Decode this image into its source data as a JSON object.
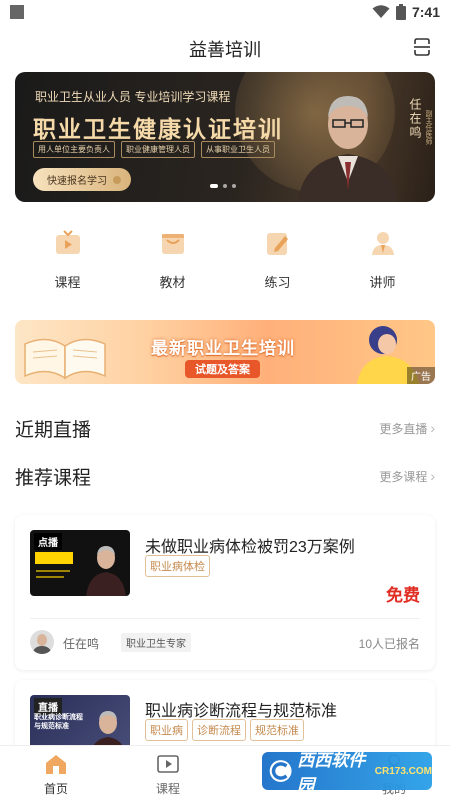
{
  "status_bar": {
    "time": "7:41"
  },
  "header": {
    "title": "益善培训"
  },
  "banner": {
    "subtitle": "职业卫生从业人员 专业培训学习课程",
    "title": "职业卫生健康认证培训",
    "tags": [
      "用人单位主要负责人",
      "职业健康管理人员",
      "从事职业卫生人员"
    ],
    "button": "快速报名学习",
    "person_name": "任在鸣",
    "person_rank": "副主任医师"
  },
  "quick_nav": [
    {
      "label": "课程",
      "icon": "tv-icon"
    },
    {
      "label": "教材",
      "icon": "book-bag-icon"
    },
    {
      "label": "练习",
      "icon": "pencil-note-icon"
    },
    {
      "label": "讲师",
      "icon": "teacher-icon"
    }
  ],
  "ad": {
    "title": "最新职业卫生培训",
    "subtitle": "试题及答案",
    "label": "广告"
  },
  "sections": {
    "live": {
      "title": "近期直播",
      "more": "更多直播"
    },
    "recommended": {
      "title": "推荐课程",
      "more": "更多课程"
    }
  },
  "courses": [
    {
      "title": "未做职业病体检被罚23万案例",
      "thumb_label": "点播",
      "tags": [
        "职业病体检"
      ],
      "price": "免费",
      "teacher": "任在鸣",
      "teacher_title": "职业卫生专家",
      "enrolled": "10人已报名"
    },
    {
      "title": "职业病诊断流程与规范标准",
      "thumb_label": "直播",
      "thumb_caption": "职业病诊断流程与规范标准",
      "tags": [
        "职业病",
        "诊断流程",
        "规范标准"
      ]
    }
  ],
  "tabbar": [
    {
      "label": "首页",
      "icon": "home-icon",
      "active": true
    },
    {
      "label": "课程",
      "icon": "play-icon",
      "active": false
    },
    {
      "label": "我的",
      "icon": "user-icon",
      "active": false
    }
  ],
  "watermark": {
    "text": "西西软件园",
    "sub": "CR173.COM"
  },
  "colors": {
    "accent": "#e02e24",
    "nav_icon": "#e9a25a",
    "tag": "#c58a4e"
  }
}
